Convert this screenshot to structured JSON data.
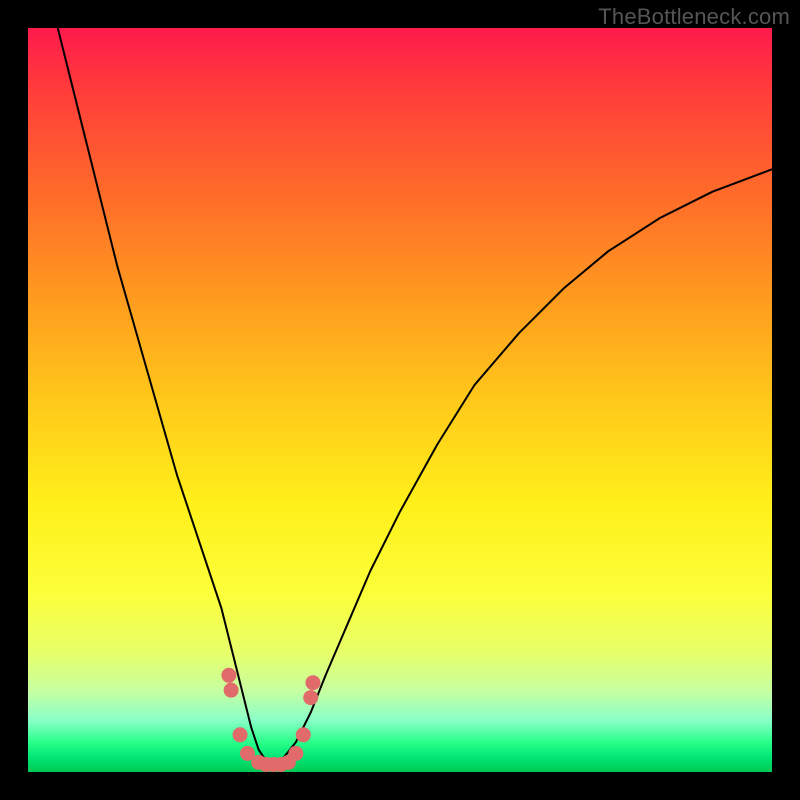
{
  "watermark": {
    "text": "TheBottleneck.com"
  },
  "colors": {
    "frame": "#000000",
    "curve_stroke": "#000000",
    "marker_fill": "#e16a6a",
    "marker_stroke": "#d05a5a",
    "gradient_stops": [
      "#ff1a4d",
      "#ff3b3b",
      "#ff6a2a",
      "#ff9a1f",
      "#ffc81a",
      "#fff01a",
      "#fcff3a",
      "#e6ff6a",
      "#c8ffa0",
      "#8affc8",
      "#2aff8a",
      "#00e676",
      "#00c853"
    ]
  },
  "chart_data": {
    "type": "line",
    "title": "",
    "xlabel": "",
    "ylabel": "",
    "xlim": [
      0,
      100
    ],
    "ylim": [
      0,
      100
    ],
    "grid": false,
    "legend": false,
    "series": [
      {
        "name": "bottleneck-curve",
        "x": [
          4,
          6,
          8,
          10,
          12,
          14,
          16,
          18,
          20,
          22,
          24,
          26,
          27,
          28,
          29,
          30,
          31,
          32,
          33,
          34,
          36,
          38,
          40,
          43,
          46,
          50,
          55,
          60,
          66,
          72,
          78,
          85,
          92,
          100
        ],
        "values": [
          100,
          92,
          84,
          76,
          68,
          61,
          54,
          47,
          40,
          34,
          28,
          22,
          18,
          14,
          10,
          6,
          3,
          1.5,
          1,
          1.5,
          4,
          8,
          13,
          20,
          27,
          35,
          44,
          52,
          59,
          65,
          70,
          74.5,
          78,
          81
        ]
      }
    ],
    "markers": [
      {
        "x": 27.0,
        "y": 13.0
      },
      {
        "x": 27.3,
        "y": 11.0
      },
      {
        "x": 28.5,
        "y": 5.0
      },
      {
        "x": 29.5,
        "y": 2.5
      },
      {
        "x": 31.0,
        "y": 1.3
      },
      {
        "x": 32.0,
        "y": 1.0
      },
      {
        "x": 33.0,
        "y": 1.0
      },
      {
        "x": 34.0,
        "y": 1.0
      },
      {
        "x": 35.0,
        "y": 1.3
      },
      {
        "x": 36.0,
        "y": 2.5
      },
      {
        "x": 37.0,
        "y": 5.0
      },
      {
        "x": 38.0,
        "y": 10.0
      },
      {
        "x": 38.3,
        "y": 12.0
      }
    ]
  }
}
